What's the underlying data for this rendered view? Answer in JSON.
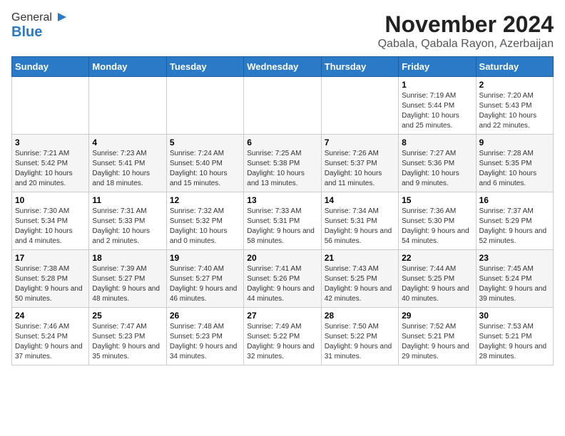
{
  "logo": {
    "line1": "General",
    "line2": "Blue"
  },
  "title": "November 2024",
  "subtitle": "Qabala, Qabala Rayon, Azerbaijan",
  "headers": [
    "Sunday",
    "Monday",
    "Tuesday",
    "Wednesday",
    "Thursday",
    "Friday",
    "Saturday"
  ],
  "weeks": [
    [
      {
        "day": "",
        "info": ""
      },
      {
        "day": "",
        "info": ""
      },
      {
        "day": "",
        "info": ""
      },
      {
        "day": "",
        "info": ""
      },
      {
        "day": "",
        "info": ""
      },
      {
        "day": "1",
        "info": "Sunrise: 7:19 AM\nSunset: 5:44 PM\nDaylight: 10 hours and 25 minutes."
      },
      {
        "day": "2",
        "info": "Sunrise: 7:20 AM\nSunset: 5:43 PM\nDaylight: 10 hours and 22 minutes."
      }
    ],
    [
      {
        "day": "3",
        "info": "Sunrise: 7:21 AM\nSunset: 5:42 PM\nDaylight: 10 hours and 20 minutes."
      },
      {
        "day": "4",
        "info": "Sunrise: 7:23 AM\nSunset: 5:41 PM\nDaylight: 10 hours and 18 minutes."
      },
      {
        "day": "5",
        "info": "Sunrise: 7:24 AM\nSunset: 5:40 PM\nDaylight: 10 hours and 15 minutes."
      },
      {
        "day": "6",
        "info": "Sunrise: 7:25 AM\nSunset: 5:38 PM\nDaylight: 10 hours and 13 minutes."
      },
      {
        "day": "7",
        "info": "Sunrise: 7:26 AM\nSunset: 5:37 PM\nDaylight: 10 hours and 11 minutes."
      },
      {
        "day": "8",
        "info": "Sunrise: 7:27 AM\nSunset: 5:36 PM\nDaylight: 10 hours and 9 minutes."
      },
      {
        "day": "9",
        "info": "Sunrise: 7:28 AM\nSunset: 5:35 PM\nDaylight: 10 hours and 6 minutes."
      }
    ],
    [
      {
        "day": "10",
        "info": "Sunrise: 7:30 AM\nSunset: 5:34 PM\nDaylight: 10 hours and 4 minutes."
      },
      {
        "day": "11",
        "info": "Sunrise: 7:31 AM\nSunset: 5:33 PM\nDaylight: 10 hours and 2 minutes."
      },
      {
        "day": "12",
        "info": "Sunrise: 7:32 AM\nSunset: 5:32 PM\nDaylight: 10 hours and 0 minutes."
      },
      {
        "day": "13",
        "info": "Sunrise: 7:33 AM\nSunset: 5:31 PM\nDaylight: 9 hours and 58 minutes."
      },
      {
        "day": "14",
        "info": "Sunrise: 7:34 AM\nSunset: 5:31 PM\nDaylight: 9 hours and 56 minutes."
      },
      {
        "day": "15",
        "info": "Sunrise: 7:36 AM\nSunset: 5:30 PM\nDaylight: 9 hours and 54 minutes."
      },
      {
        "day": "16",
        "info": "Sunrise: 7:37 AM\nSunset: 5:29 PM\nDaylight: 9 hours and 52 minutes."
      }
    ],
    [
      {
        "day": "17",
        "info": "Sunrise: 7:38 AM\nSunset: 5:28 PM\nDaylight: 9 hours and 50 minutes."
      },
      {
        "day": "18",
        "info": "Sunrise: 7:39 AM\nSunset: 5:27 PM\nDaylight: 9 hours and 48 minutes."
      },
      {
        "day": "19",
        "info": "Sunrise: 7:40 AM\nSunset: 5:27 PM\nDaylight: 9 hours and 46 minutes."
      },
      {
        "day": "20",
        "info": "Sunrise: 7:41 AM\nSunset: 5:26 PM\nDaylight: 9 hours and 44 minutes."
      },
      {
        "day": "21",
        "info": "Sunrise: 7:43 AM\nSunset: 5:25 PM\nDaylight: 9 hours and 42 minutes."
      },
      {
        "day": "22",
        "info": "Sunrise: 7:44 AM\nSunset: 5:25 PM\nDaylight: 9 hours and 40 minutes."
      },
      {
        "day": "23",
        "info": "Sunrise: 7:45 AM\nSunset: 5:24 PM\nDaylight: 9 hours and 39 minutes."
      }
    ],
    [
      {
        "day": "24",
        "info": "Sunrise: 7:46 AM\nSunset: 5:24 PM\nDaylight: 9 hours and 37 minutes."
      },
      {
        "day": "25",
        "info": "Sunrise: 7:47 AM\nSunset: 5:23 PM\nDaylight: 9 hours and 35 minutes."
      },
      {
        "day": "26",
        "info": "Sunrise: 7:48 AM\nSunset: 5:23 PM\nDaylight: 9 hours and 34 minutes."
      },
      {
        "day": "27",
        "info": "Sunrise: 7:49 AM\nSunset: 5:22 PM\nDaylight: 9 hours and 32 minutes."
      },
      {
        "day": "28",
        "info": "Sunrise: 7:50 AM\nSunset: 5:22 PM\nDaylight: 9 hours and 31 minutes."
      },
      {
        "day": "29",
        "info": "Sunrise: 7:52 AM\nSunset: 5:21 PM\nDaylight: 9 hours and 29 minutes."
      },
      {
        "day": "30",
        "info": "Sunrise: 7:53 AM\nSunset: 5:21 PM\nDaylight: 9 hours and 28 minutes."
      }
    ]
  ]
}
